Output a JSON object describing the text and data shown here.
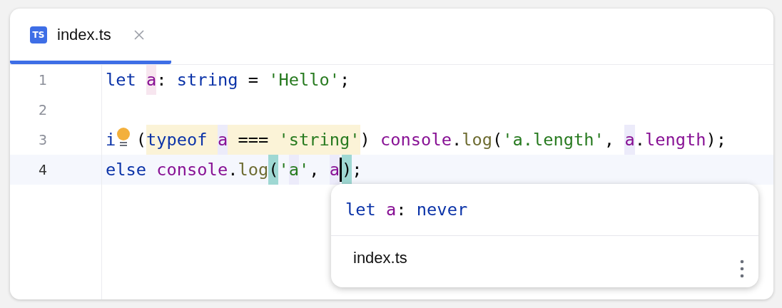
{
  "tabs": [
    {
      "label": "index.ts",
      "icon": "TS",
      "selected": true
    }
  ],
  "lines": [
    {
      "number": "1",
      "current": false,
      "tokens": [
        {
          "text": "let ",
          "kind": "keyword"
        },
        {
          "text": "a",
          "kind": "var",
          "color": "#f7e6ef"
        },
        {
          "text": ": ",
          "kind": "plain"
        },
        {
          "text": "string",
          "kind": "keyword"
        },
        {
          "text": " = ",
          "kind": "plain"
        },
        {
          "text": "'Hello'",
          "kind": "string"
        },
        {
          "text": ";",
          "kind": "plain"
        }
      ]
    },
    {
      "number": "2",
      "current": false
    },
    {
      "number": "3",
      "current": false,
      "tokens": [
        {
          "text": "i",
          "kind": "keyword"
        },
        {
          "kind": "bulb"
        },
        {
          "text": " (",
          "kind": "plain"
        },
        {
          "text": "typeof ",
          "kind": "keyword",
          "color": "#fbf3d7"
        },
        {
          "text": "a",
          "kind": "var",
          "color": "#ecebfa"
        },
        {
          "text": " === ",
          "kind": "plain",
          "color": "#fbf3d7"
        },
        {
          "text": "'string'",
          "kind": "string",
          "color": "#fbf3d7"
        },
        {
          "text": ") ",
          "kind": "plain"
        },
        {
          "text": "console",
          "kind": "var"
        },
        {
          "text": ".",
          "kind": "plain"
        },
        {
          "text": "log",
          "kind": "func"
        },
        {
          "text": "(",
          "kind": "plain"
        },
        {
          "text": "'a.length'",
          "kind": "string"
        },
        {
          "text": ", ",
          "kind": "plain"
        },
        {
          "text": "a",
          "kind": "var",
          "color": "#ecebfa"
        },
        {
          "text": ".",
          "kind": "plain"
        },
        {
          "text": "length",
          "kind": "var"
        },
        {
          "text": ");",
          "kind": "plain"
        }
      ]
    },
    {
      "number": "4",
      "current": true,
      "tokens": [
        {
          "text": "else ",
          "kind": "keyword"
        },
        {
          "text": "console",
          "kind": "var"
        },
        {
          "text": ".",
          "kind": "plain"
        },
        {
          "text": "log",
          "kind": "func"
        },
        {
          "text": "(",
          "kind": "plain",
          "color": "#9fd8d3"
        },
        {
          "text": "'",
          "kind": "string"
        },
        {
          "text": "a",
          "kind": "string",
          "color": "#ecebfa"
        },
        {
          "text": "'",
          "kind": "string"
        },
        {
          "text": ", ",
          "kind": "plain"
        },
        {
          "text": "a",
          "kind": "var",
          "color": "#ecebfa"
        },
        {
          "kind": "caret"
        },
        {
          "text": ")",
          "kind": "plain",
          "color": "#9fd8d3"
        },
        {
          "text": ";",
          "kind": "plain"
        }
      ]
    }
  ],
  "popup": {
    "signature": [
      {
        "text": "let ",
        "kind": "keyword"
      },
      {
        "text": "a",
        "kind": "var"
      },
      {
        "text": ": ",
        "kind": "plain"
      },
      {
        "text": "never",
        "kind": "keyword"
      }
    ],
    "file": "index.ts"
  }
}
